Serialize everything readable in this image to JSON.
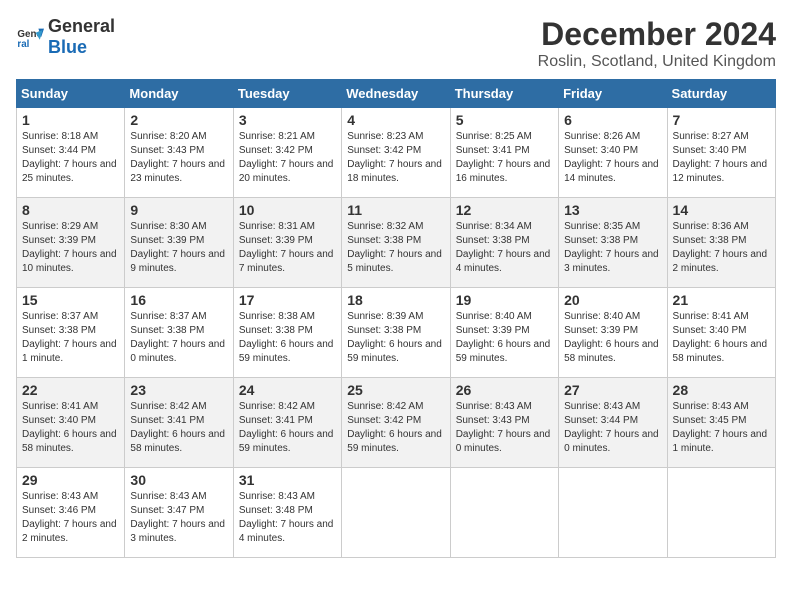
{
  "header": {
    "logo_general": "General",
    "logo_blue": "Blue",
    "title": "December 2024",
    "subtitle": "Roslin, Scotland, United Kingdom"
  },
  "columns": [
    "Sunday",
    "Monday",
    "Tuesday",
    "Wednesday",
    "Thursday",
    "Friday",
    "Saturday"
  ],
  "weeks": [
    [
      {
        "num": "1",
        "sunrise": "8:18 AM",
        "sunset": "3:44 PM",
        "daylight": "7 hours and 25 minutes."
      },
      {
        "num": "2",
        "sunrise": "8:20 AM",
        "sunset": "3:43 PM",
        "daylight": "7 hours and 23 minutes."
      },
      {
        "num": "3",
        "sunrise": "8:21 AM",
        "sunset": "3:42 PM",
        "daylight": "7 hours and 20 minutes."
      },
      {
        "num": "4",
        "sunrise": "8:23 AM",
        "sunset": "3:42 PM",
        "daylight": "7 hours and 18 minutes."
      },
      {
        "num": "5",
        "sunrise": "8:25 AM",
        "sunset": "3:41 PM",
        "daylight": "7 hours and 16 minutes."
      },
      {
        "num": "6",
        "sunrise": "8:26 AM",
        "sunset": "3:40 PM",
        "daylight": "7 hours and 14 minutes."
      },
      {
        "num": "7",
        "sunrise": "8:27 AM",
        "sunset": "3:40 PM",
        "daylight": "7 hours and 12 minutes."
      }
    ],
    [
      {
        "num": "8",
        "sunrise": "8:29 AM",
        "sunset": "3:39 PM",
        "daylight": "7 hours and 10 minutes."
      },
      {
        "num": "9",
        "sunrise": "8:30 AM",
        "sunset": "3:39 PM",
        "daylight": "7 hours and 9 minutes."
      },
      {
        "num": "10",
        "sunrise": "8:31 AM",
        "sunset": "3:39 PM",
        "daylight": "7 hours and 7 minutes."
      },
      {
        "num": "11",
        "sunrise": "8:32 AM",
        "sunset": "3:38 PM",
        "daylight": "7 hours and 5 minutes."
      },
      {
        "num": "12",
        "sunrise": "8:34 AM",
        "sunset": "3:38 PM",
        "daylight": "7 hours and 4 minutes."
      },
      {
        "num": "13",
        "sunrise": "8:35 AM",
        "sunset": "3:38 PM",
        "daylight": "7 hours and 3 minutes."
      },
      {
        "num": "14",
        "sunrise": "8:36 AM",
        "sunset": "3:38 PM",
        "daylight": "7 hours and 2 minutes."
      }
    ],
    [
      {
        "num": "15",
        "sunrise": "8:37 AM",
        "sunset": "3:38 PM",
        "daylight": "7 hours and 1 minute."
      },
      {
        "num": "16",
        "sunrise": "8:37 AM",
        "sunset": "3:38 PM",
        "daylight": "7 hours and 0 minutes."
      },
      {
        "num": "17",
        "sunrise": "8:38 AM",
        "sunset": "3:38 PM",
        "daylight": "6 hours and 59 minutes."
      },
      {
        "num": "18",
        "sunrise": "8:39 AM",
        "sunset": "3:38 PM",
        "daylight": "6 hours and 59 minutes."
      },
      {
        "num": "19",
        "sunrise": "8:40 AM",
        "sunset": "3:39 PM",
        "daylight": "6 hours and 59 minutes."
      },
      {
        "num": "20",
        "sunrise": "8:40 AM",
        "sunset": "3:39 PM",
        "daylight": "6 hours and 58 minutes."
      },
      {
        "num": "21",
        "sunrise": "8:41 AM",
        "sunset": "3:40 PM",
        "daylight": "6 hours and 58 minutes."
      }
    ],
    [
      {
        "num": "22",
        "sunrise": "8:41 AM",
        "sunset": "3:40 PM",
        "daylight": "6 hours and 58 minutes."
      },
      {
        "num": "23",
        "sunrise": "8:42 AM",
        "sunset": "3:41 PM",
        "daylight": "6 hours and 58 minutes."
      },
      {
        "num": "24",
        "sunrise": "8:42 AM",
        "sunset": "3:41 PM",
        "daylight": "6 hours and 59 minutes."
      },
      {
        "num": "25",
        "sunrise": "8:42 AM",
        "sunset": "3:42 PM",
        "daylight": "6 hours and 59 minutes."
      },
      {
        "num": "26",
        "sunrise": "8:43 AM",
        "sunset": "3:43 PM",
        "daylight": "7 hours and 0 minutes."
      },
      {
        "num": "27",
        "sunrise": "8:43 AM",
        "sunset": "3:44 PM",
        "daylight": "7 hours and 0 minutes."
      },
      {
        "num": "28",
        "sunrise": "8:43 AM",
        "sunset": "3:45 PM",
        "daylight": "7 hours and 1 minute."
      }
    ],
    [
      {
        "num": "29",
        "sunrise": "8:43 AM",
        "sunset": "3:46 PM",
        "daylight": "7 hours and 2 minutes."
      },
      {
        "num": "30",
        "sunrise": "8:43 AM",
        "sunset": "3:47 PM",
        "daylight": "7 hours and 3 minutes."
      },
      {
        "num": "31",
        "sunrise": "8:43 AM",
        "sunset": "3:48 PM",
        "daylight": "7 hours and 4 minutes."
      },
      null,
      null,
      null,
      null
    ]
  ]
}
